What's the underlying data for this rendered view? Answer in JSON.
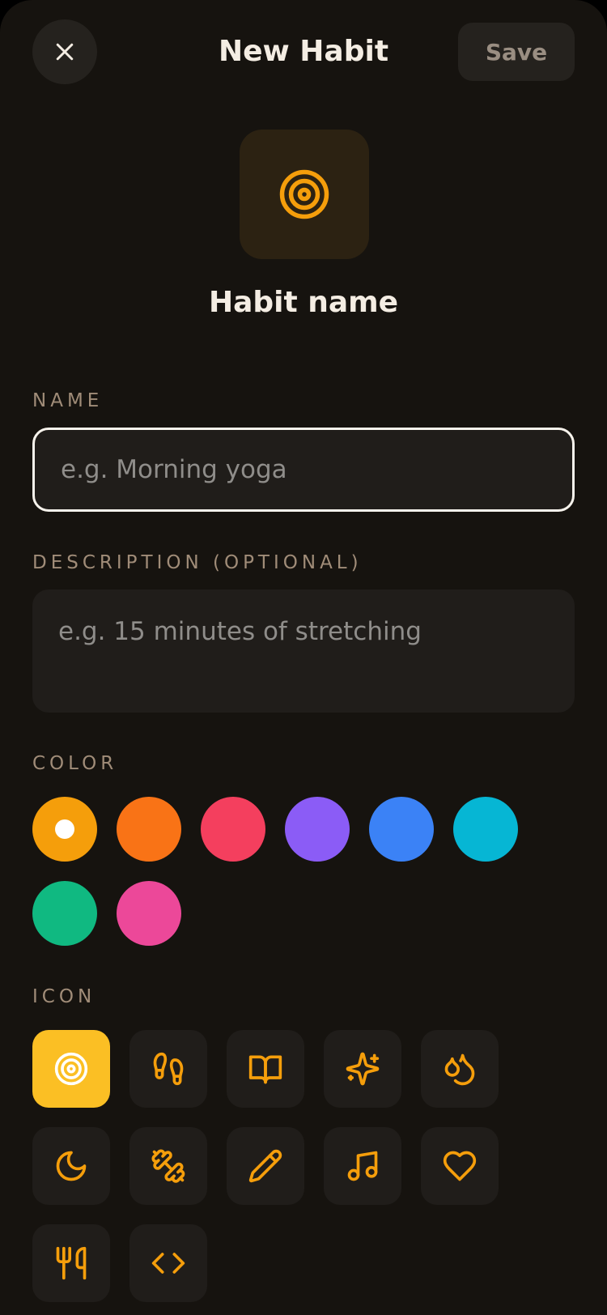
{
  "header": {
    "title": "New Habit",
    "save_label": "Save",
    "close_icon": "close-icon"
  },
  "preview": {
    "icon": "target-icon",
    "name": "Habit name",
    "accent": "#f59e0b",
    "tile_bg": "#2c2212"
  },
  "form": {
    "name_label": "NAME",
    "name_value": "",
    "name_placeholder": "e.g. Morning yoga",
    "description_label": "DESCRIPTION (OPTIONAL)",
    "description_value": "",
    "description_placeholder": "e.g. 15 minutes of stretching",
    "color_label": "COLOR",
    "icon_label": "ICON"
  },
  "colors": [
    {
      "hex": "#f59e0b",
      "selected": true
    },
    {
      "hex": "#f97316",
      "selected": false
    },
    {
      "hex": "#f43f5e",
      "selected": false
    },
    {
      "hex": "#8b5cf6",
      "selected": false
    },
    {
      "hex": "#3b82f6",
      "selected": false
    },
    {
      "hex": "#06b6d4",
      "selected": false
    },
    {
      "hex": "#10b981",
      "selected": false
    },
    {
      "hex": "#ec4899",
      "selected": false
    }
  ],
  "icons": [
    {
      "name": "target-icon",
      "selected": true
    },
    {
      "name": "footprints-icon",
      "selected": false
    },
    {
      "name": "book-open-icon",
      "selected": false
    },
    {
      "name": "sparkles-icon",
      "selected": false
    },
    {
      "name": "droplets-icon",
      "selected": false
    },
    {
      "name": "moon-icon",
      "selected": false
    },
    {
      "name": "dumbbell-icon",
      "selected": false
    },
    {
      "name": "pencil-icon",
      "selected": false
    },
    {
      "name": "music-icon",
      "selected": false
    },
    {
      "name": "heart-icon",
      "selected": false
    },
    {
      "name": "utensils-icon",
      "selected": false
    },
    {
      "name": "code-icon",
      "selected": false
    }
  ],
  "theme": {
    "background": "#16130f",
    "surface": "#201d1a",
    "icon_selected_bg": "#fbbf24",
    "icon_stroke": "#f59e0b"
  }
}
